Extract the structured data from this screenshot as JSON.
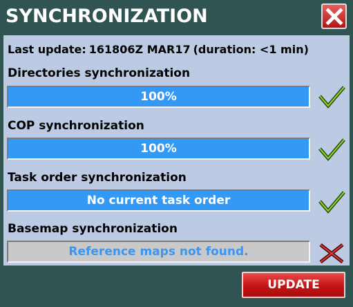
{
  "window": {
    "title": "SYNCHRONIZATION",
    "close_icon": "close-x-icon"
  },
  "last_update": {
    "label": "Last update:",
    "value": "161806Z MAR17",
    "duration": "(duration: <1 min)"
  },
  "sections": [
    {
      "label": "Directories synchronization",
      "bar_text": "100%",
      "progress": 1.0,
      "status": "success",
      "status_icon": "checkmark-icon"
    },
    {
      "label": "COP synchronization",
      "bar_text": "100%",
      "progress": 1.0,
      "status": "success",
      "status_icon": "checkmark-icon"
    },
    {
      "label": "Task order synchronization",
      "bar_text": "No current task order",
      "progress": 1.0,
      "status": "success",
      "status_icon": "checkmark-icon"
    },
    {
      "label": "Basemap synchronization",
      "bar_text": "Reference maps not found.",
      "progress": 0.0,
      "status": "error",
      "status_icon": "cross-icon"
    }
  ],
  "buttons": {
    "update_label": "UPDATE"
  },
  "colors": {
    "window_bg": "#2f5452",
    "panel_bg": "#bccbe3",
    "progress_fill": "#3499f5",
    "progress_track": "#c9c9c9",
    "accent_red": "#c41414",
    "check_green": "#3a7a00"
  }
}
